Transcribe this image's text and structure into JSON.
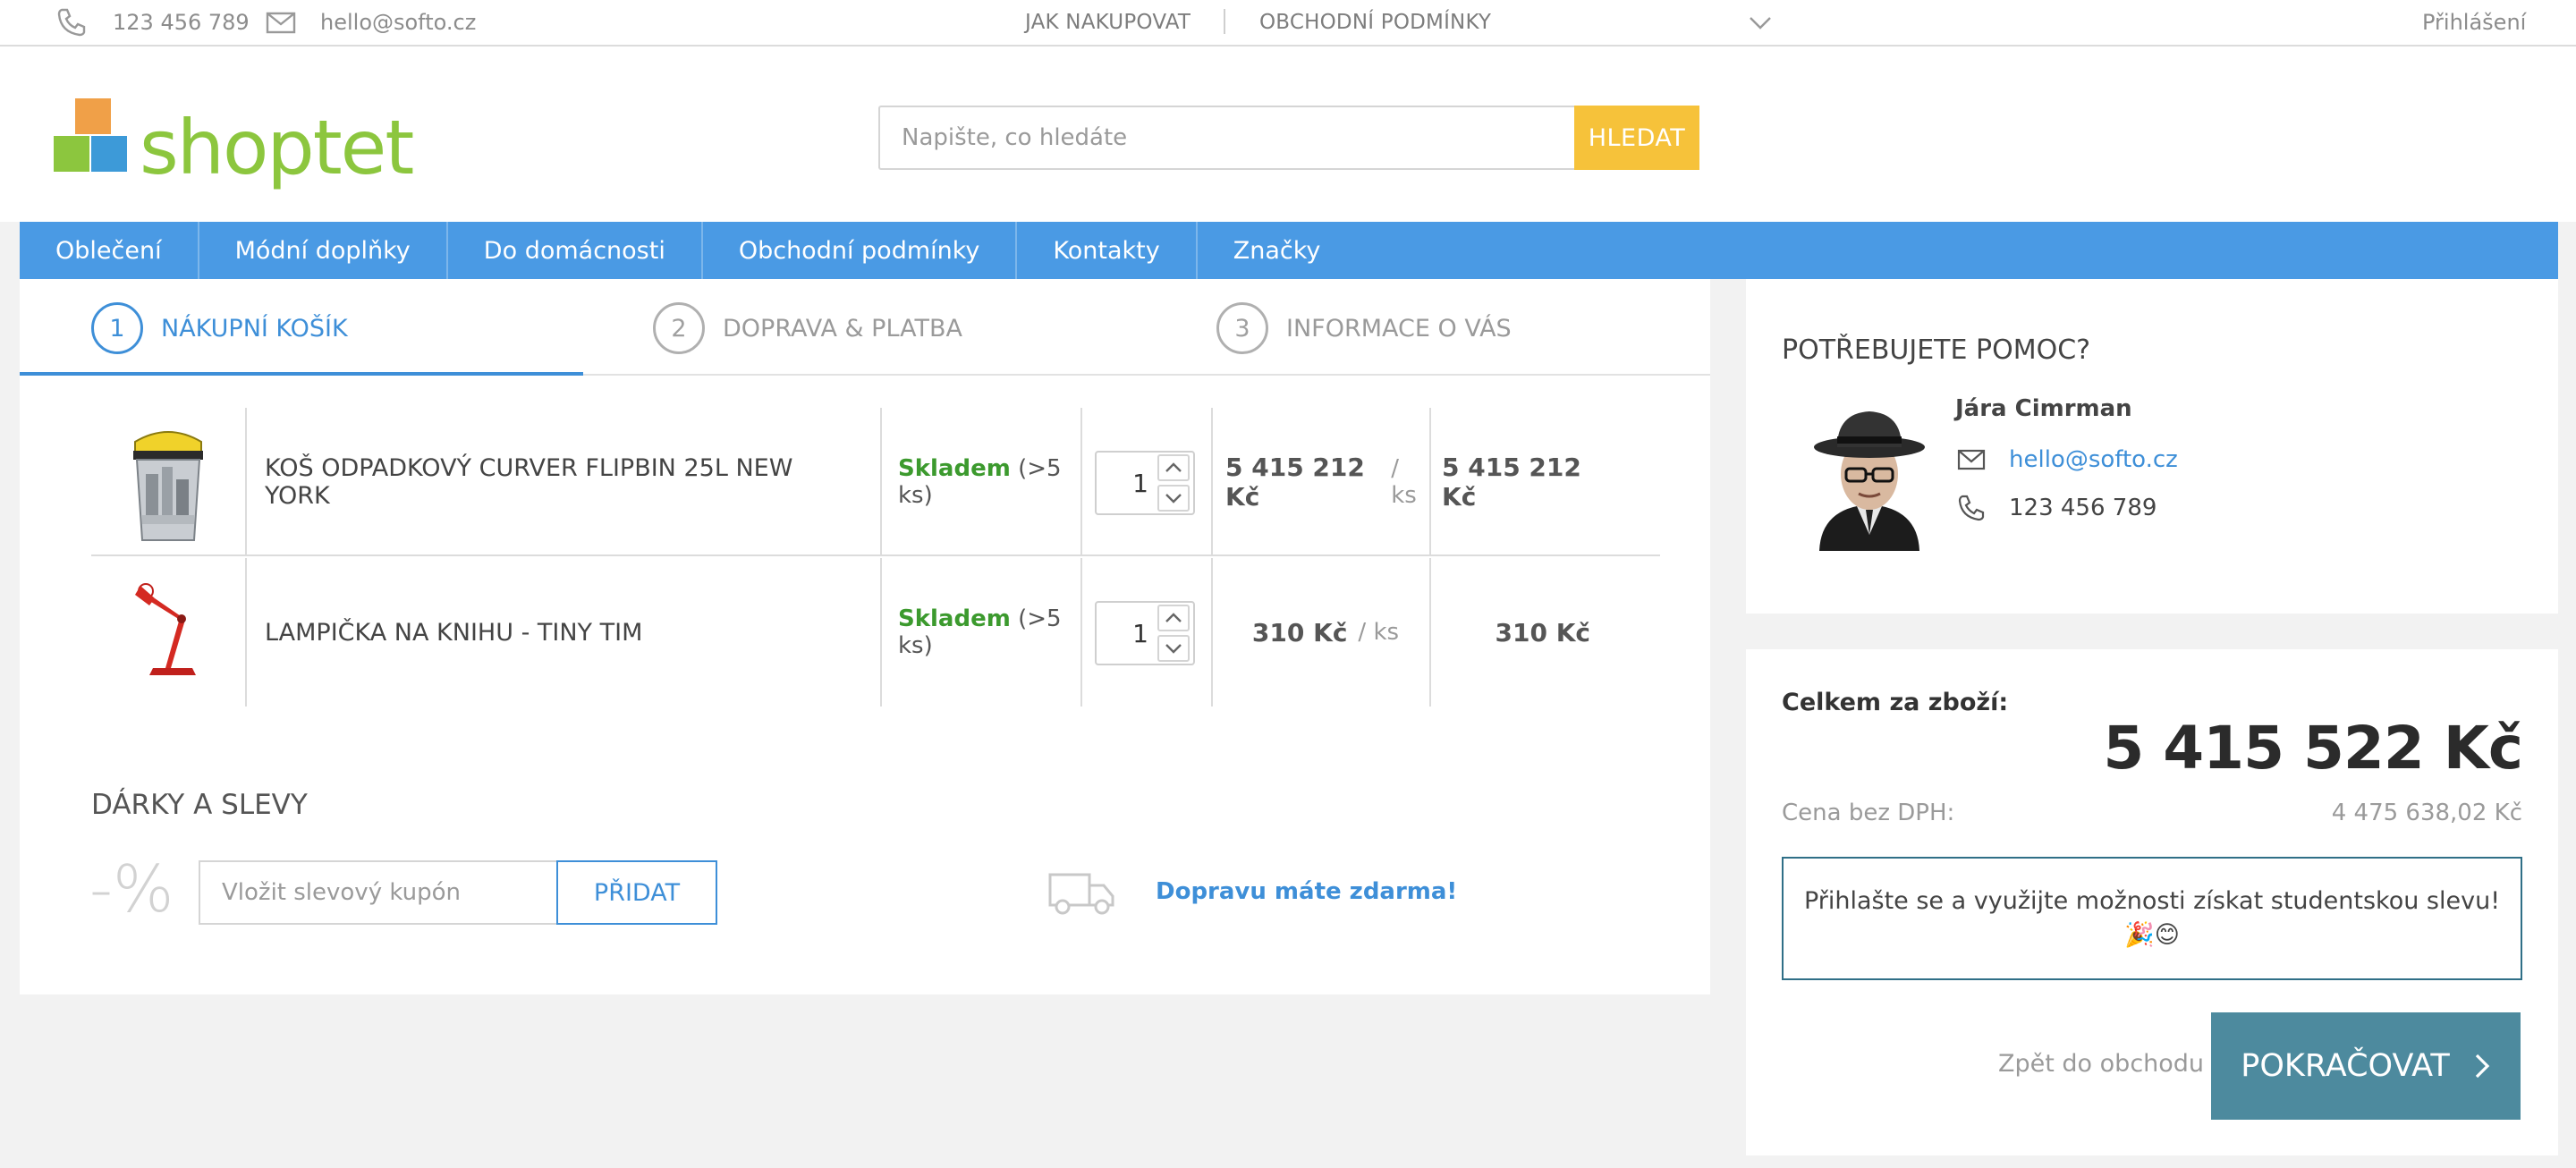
{
  "topbar": {
    "phone": "123 456 789",
    "email": "hello@softo.cz",
    "nav": [
      "JAK NAKUPOVAT",
      "OBCHODNÍ PODMÍNKY"
    ],
    "login": "Přihlášení"
  },
  "header": {
    "logo_text": "shoptet",
    "search_placeholder": "Napište, co hledáte",
    "search_button": "HLEDAT"
  },
  "menu": [
    "Oblečení",
    "Módní doplňky",
    "Do domácnosti",
    "Obchodní podmínky",
    "Kontakty",
    "Značky"
  ],
  "steps": [
    {
      "num": "1",
      "label": "NÁKUPNÍ KOŠÍK"
    },
    {
      "num": "2",
      "label": "DOPRAVA & PLATBA"
    },
    {
      "num": "3",
      "label": "INFORMACE O VÁS"
    }
  ],
  "cart": [
    {
      "name": "KOŠ ODPADKOVÝ CURVER FLIPBIN 25L NEW YORK",
      "stock": "Skladem",
      "stock_note": "(>5 ks)",
      "qty": "1",
      "unit_price": "5 415 212 Kč",
      "unit": "/ ks",
      "total": "5 415 212 Kč"
    },
    {
      "name": "LAMPIČKA NA KNIHU - TINY TIM",
      "stock": "Skladem",
      "stock_note": "(>5 ks)",
      "qty": "1",
      "unit_price": "310 Kč",
      "unit": "/ ks",
      "total": "310 Kč"
    }
  ],
  "gifts": {
    "title": "DÁRKY A SLEVY",
    "percent": "-%",
    "coupon_placeholder": "Vložit slevový kupón",
    "add_button": "PŘIDAT",
    "free_shipping": "Dopravu máte zdarma!"
  },
  "help": {
    "title": "POTŘEBUJETE POMOC?",
    "name": "Jára Cimrman",
    "email": "hello@softo.cz",
    "phone": "123 456 789"
  },
  "summary": {
    "label": "Celkem za zboží:",
    "total": "5 415 522 Kč",
    "net_label": "Cena bez DPH:",
    "net": "4 475 638,02 Kč",
    "promo_line1": "Přihlašte se a využijte možnosti získat studentskou slevu!",
    "promo_line2": "🎉😊",
    "back": "Zpět do obchodu",
    "continue": "POKRAČOVAT"
  },
  "colors": {
    "accent": "#4a9ae4",
    "link": "#3e8fd8",
    "search_button": "#f6c23a",
    "continue_button": "#4d8a9e",
    "in_stock": "#3c9a2e"
  }
}
